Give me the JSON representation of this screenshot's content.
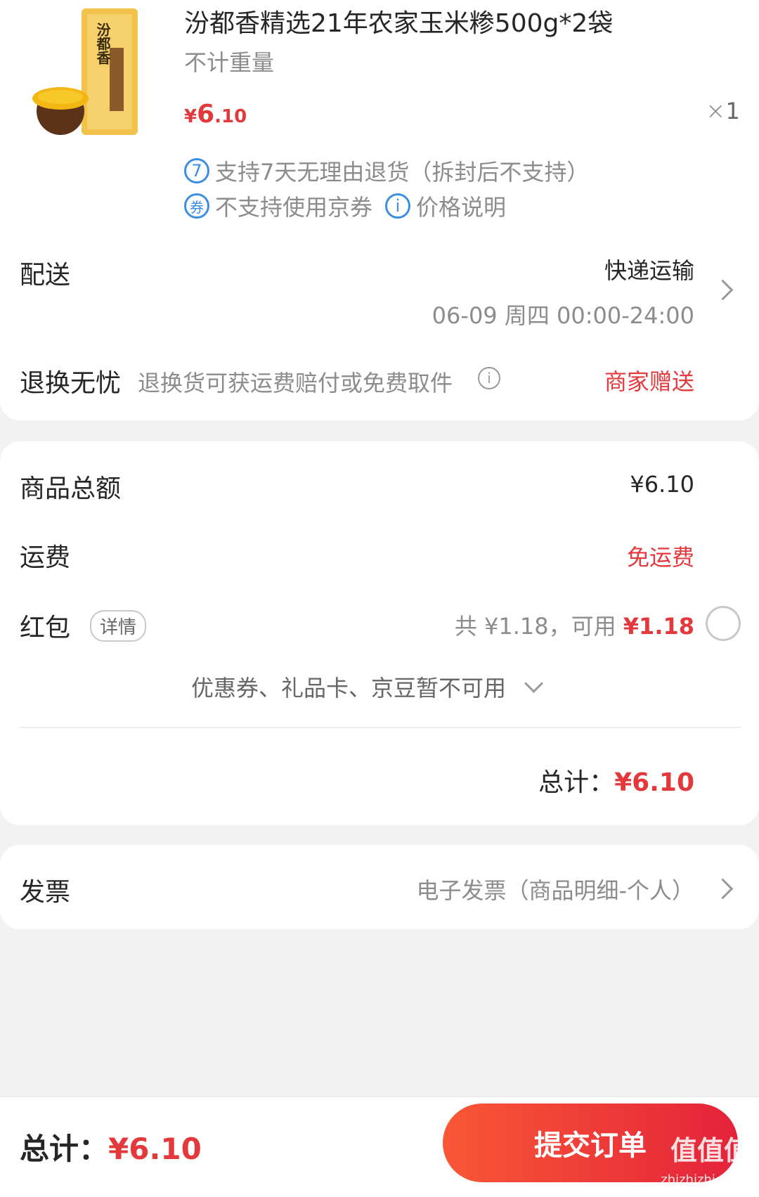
{
  "product": {
    "title": "汾都香精选21年农家玉米糁500g*2袋",
    "spec": "不计重量",
    "price_symbol": "¥",
    "price_int": "6",
    "price_dec": ".10",
    "qty_symbol": "×",
    "qty": "1",
    "image_brand_text": "汾都香",
    "services": [
      {
        "icon": "7",
        "text": "支持7天无理由退货（拆封后不支持）"
      },
      {
        "icon": "券",
        "text": "不支持使用京券"
      },
      {
        "icon": "i",
        "text": "价格说明"
      }
    ]
  },
  "delivery": {
    "label": "配送",
    "method": "快递运输",
    "time": "06-09 周四 00:00-24:00"
  },
  "return_service": {
    "label": "退换无忧",
    "desc": "退换货可获运费赔付或免费取件",
    "info_icon": "i",
    "value": "商家赠送"
  },
  "summary": {
    "goods_total_label": "商品总额",
    "goods_total_value": "¥6.10",
    "shipping_label": "运费",
    "shipping_value": "免运费",
    "redpacket_label": "红包",
    "redpacket_tag": "详情",
    "redpacket_total": "共 ¥1.18，可用 ",
    "redpacket_available": "¥1.18",
    "coupons_note": "优惠券、礼品卡、京豆暂不可用",
    "total_label": "总计：",
    "total_value": "¥6.10"
  },
  "invoice": {
    "label": "发票",
    "value": "电子发票（商品明细-个人）"
  },
  "footer": {
    "total_label": "总计：",
    "total_value": "¥6.10",
    "submit_label": "提交订单",
    "watermark": "值值值",
    "watermark_sub": "zhizhizhi.com"
  },
  "colors": {
    "accent_red": "#e4393c",
    "service_blue": "#3b8ee2"
  }
}
